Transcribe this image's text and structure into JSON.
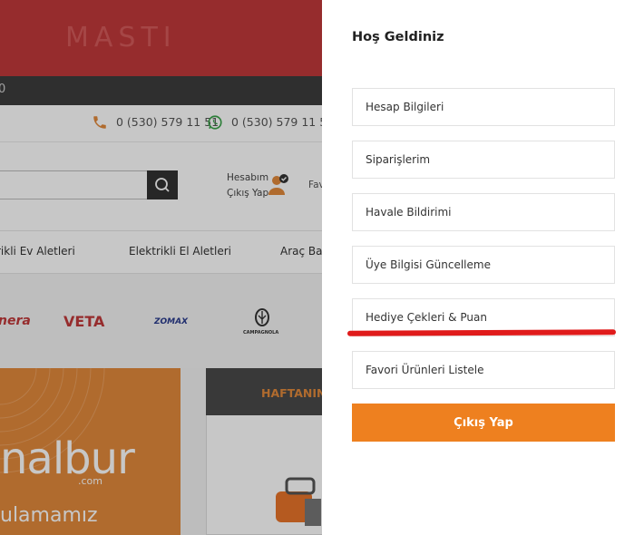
{
  "background_site": {
    "banner_text": "MASTI",
    "topbar_text": "0",
    "phones": [
      "0 (530) 579 11 51",
      "0 (530) 579 11 51"
    ],
    "account": {
      "line1": "Hesabım",
      "line2": "Çıkış Yap"
    },
    "favorites_partial": "Fav",
    "nav_items": [
      "rikli Ev Aletleri",
      "Elektrikli El Aletleri",
      "Araç Bakı"
    ],
    "brands": [
      "nera",
      "VETA",
      "ZOMAX",
      "CAMPAGNOLA"
    ],
    "promo": {
      "big_text": "nalbur",
      "small_text": ".com",
      "bottom_text": "ulamamız"
    },
    "week_title": "HAFTANIN",
    "colors": {
      "accent": "#ee801f",
      "banner": "#c0393a",
      "dark_bar": "#3d3d3d"
    }
  },
  "panel": {
    "title": "Hoş Geldiniz",
    "menu": [
      {
        "label": "Hesap Bilgileri"
      },
      {
        "label": "Siparişlerim"
      },
      {
        "label": "Havale Bildirimi"
      },
      {
        "label": "Üye Bilgisi Güncelleme"
      },
      {
        "label": "Hediye Çekleri & Puan"
      },
      {
        "label": "Favori Ürünleri Listele"
      }
    ],
    "logout_label": "Çıkış Yap",
    "colors": {
      "logout_bg": "#ee801f",
      "annotation_underline": "#e01b1b"
    }
  }
}
